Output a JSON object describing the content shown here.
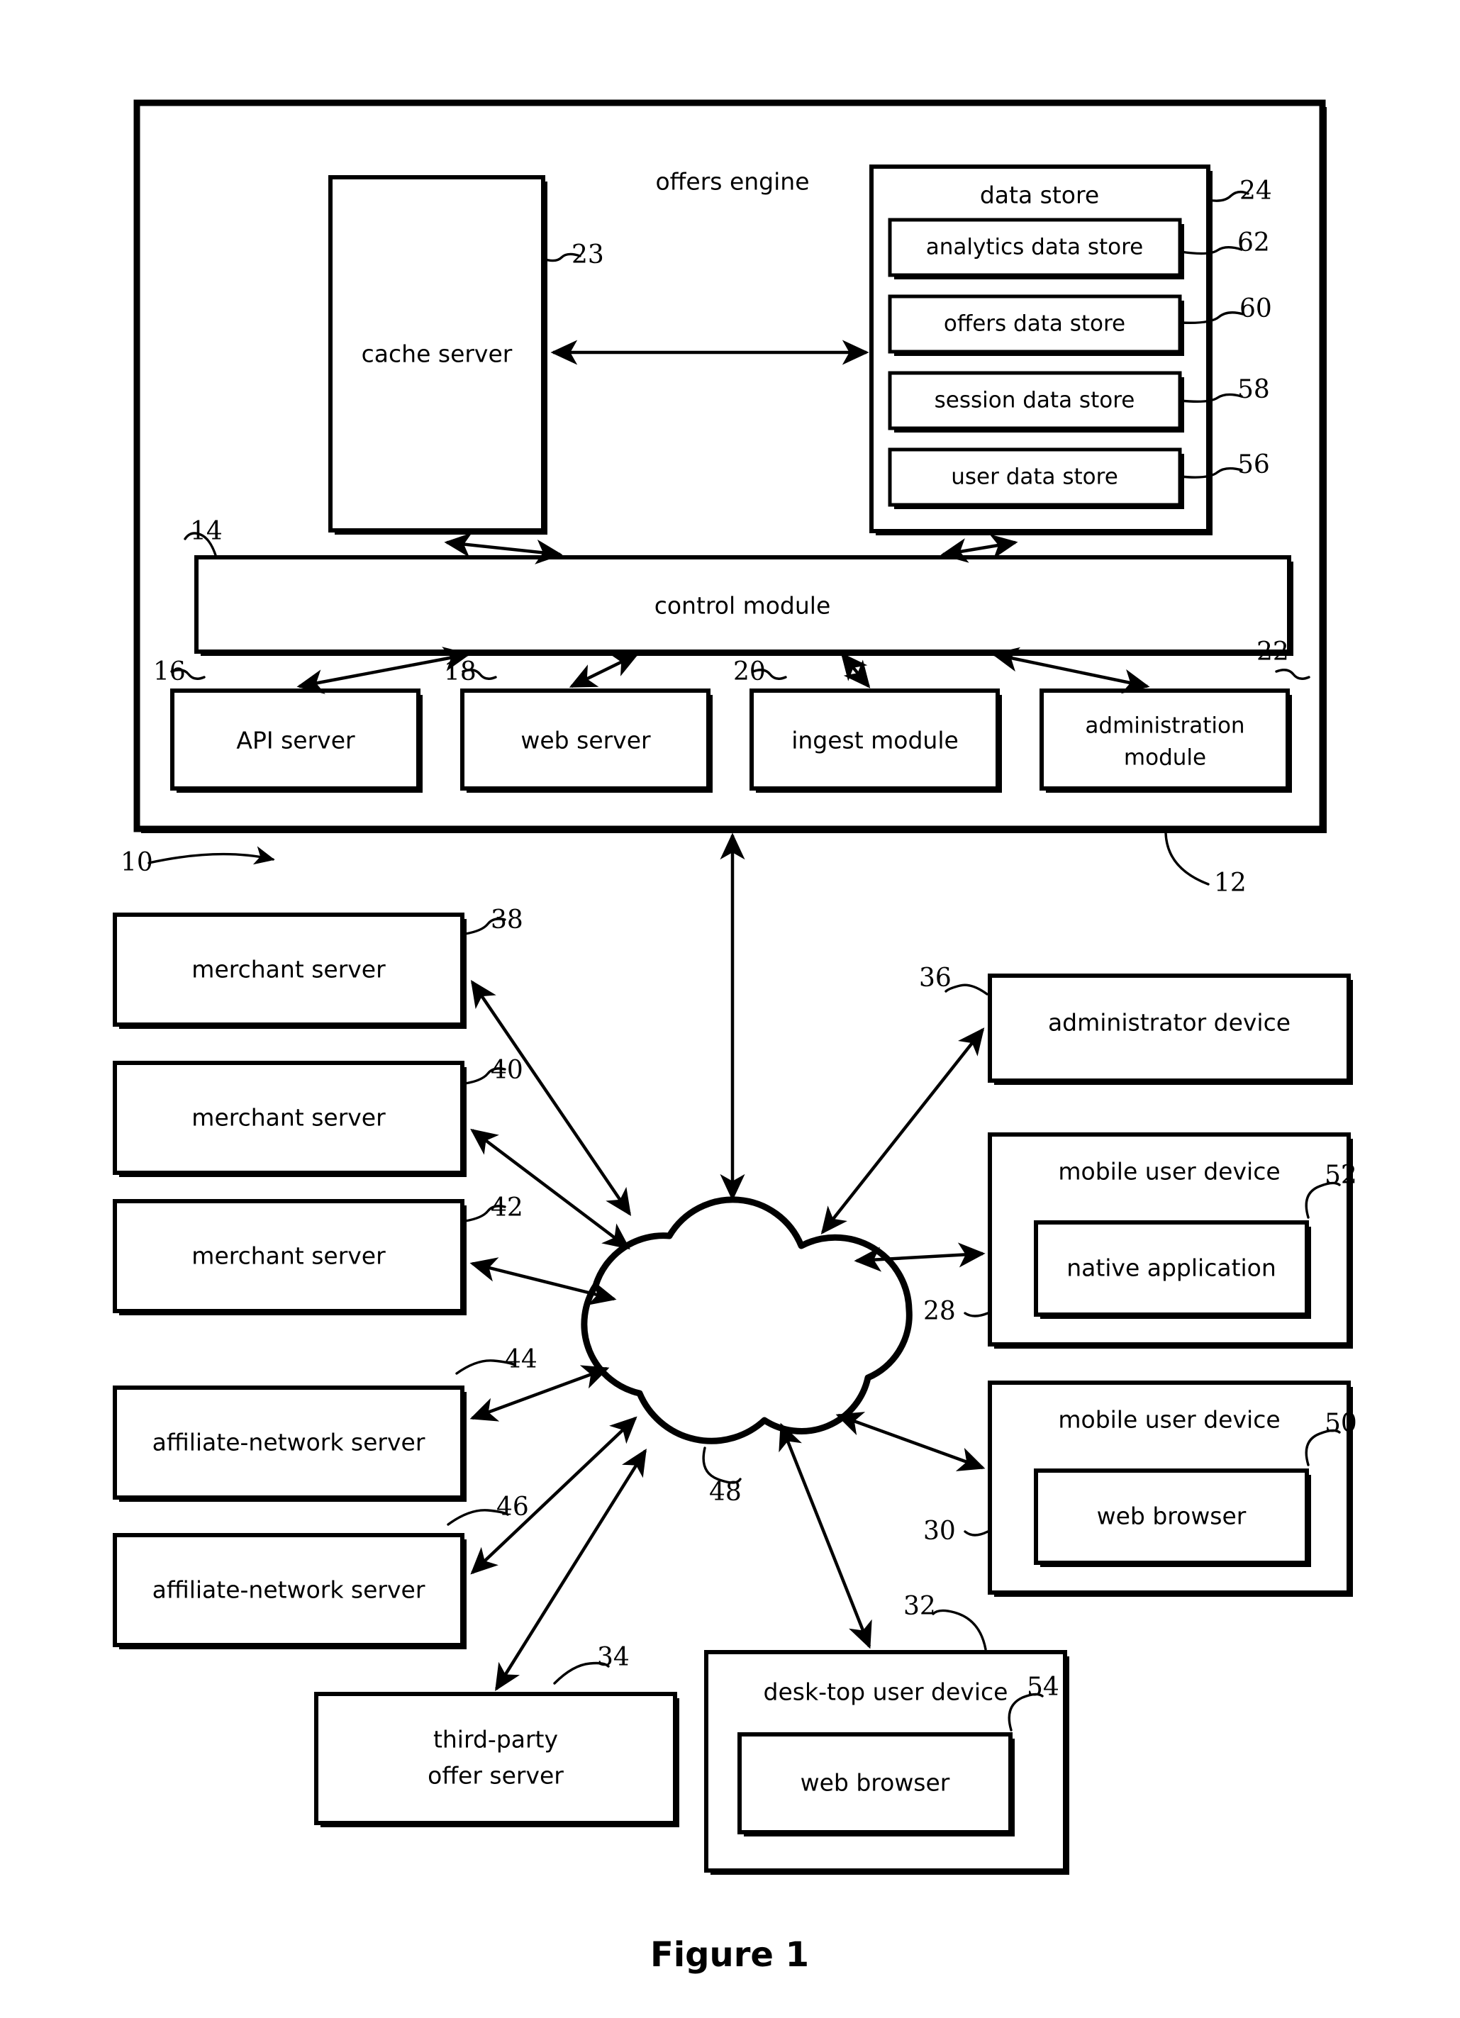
{
  "figure": {
    "caption": "Figure 1",
    "system_ref": "10",
    "offers_engine_ref": "12",
    "offers_engine_label": "offers engine"
  },
  "offers_engine": {
    "title": "offers engine",
    "cache_server": {
      "label": "cache server",
      "ref": "23"
    },
    "data_store": {
      "label": "data store",
      "ref": "24",
      "items": [
        {
          "label": "analytics data store",
          "ref": "62"
        },
        {
          "label": "offers data store",
          "ref": "60"
        },
        {
          "label": "session data store",
          "ref": "58"
        },
        {
          "label": "user data store",
          "ref": "56"
        }
      ]
    },
    "control_module": {
      "label": "control module",
      "ref": "14"
    },
    "modules": [
      {
        "label": "API server",
        "ref": "16"
      },
      {
        "label": "web server",
        "ref": "18"
      },
      {
        "label": "ingest module",
        "ref": "20"
      },
      {
        "label": "administration module",
        "line1": "administration",
        "line2": "module",
        "ref": "22"
      }
    ]
  },
  "network": {
    "label": "network cloud",
    "ref": "48"
  },
  "left_nodes": [
    {
      "label": "merchant server",
      "ref": "38"
    },
    {
      "label": "merchant server",
      "ref": "40"
    },
    {
      "label": "merchant server",
      "ref": "42"
    },
    {
      "label": "affiliate-network server",
      "ref": "44"
    },
    {
      "label": "affiliate-network server",
      "ref": "46"
    }
  ],
  "third_party": {
    "line1": "third-party",
    "line2": "offer server",
    "ref": "34"
  },
  "right_nodes": [
    {
      "label": "administrator device",
      "ref": "36",
      "inner": null
    },
    {
      "label": "mobile user device",
      "ref": "28",
      "inner": {
        "label": "native application",
        "ref": "52"
      }
    },
    {
      "label": "mobile user device",
      "ref": "30",
      "inner": {
        "label": "web browser",
        "ref": "50"
      }
    }
  ],
  "desktop": {
    "label": "desk-top user device",
    "ref": "32",
    "inner": {
      "label": "web browser",
      "ref": "54"
    }
  },
  "colors": {
    "ink": "#000000",
    "paper": "#ffffff"
  }
}
